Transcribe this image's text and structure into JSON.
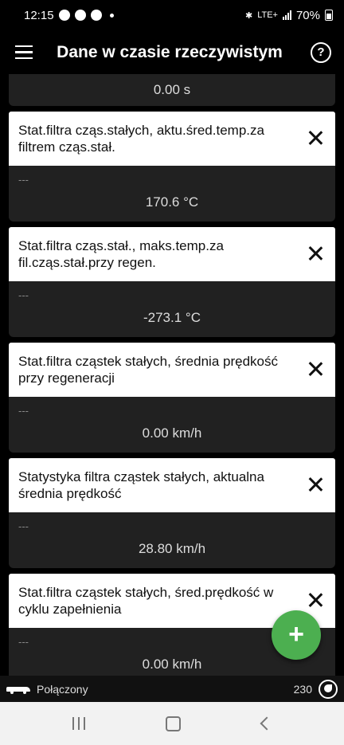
{
  "status_bar": {
    "time": "12:15",
    "network": "LTE+",
    "battery": "70%"
  },
  "app_bar": {
    "title": "Dane w czasie rzeczywistym",
    "help": "?"
  },
  "top_card": {
    "value": "0.00 s"
  },
  "cards": [
    {
      "title": "Stat.filtra cząs.stałych, aktu.śred.temp.za filtrem cząs.stał.",
      "sub": "---",
      "value": "170.6 °C"
    },
    {
      "title": "Stat.filtra cząs.stał., maks.temp.za fil.cząs.stał.przy regen.",
      "sub": "---",
      "value": "-273.1 °C"
    },
    {
      "title": "Stat.filtra cząstek stałych, średnia prędkość przy regeneracji",
      "sub": "---",
      "value": "0.00 km/h"
    },
    {
      "title": "Statystyka filtra cząstek stałych, aktualna średnia prędkość",
      "sub": "---",
      "value": "28.80 km/h"
    },
    {
      "title": "Stat.filtra cząstek stałych, śred.prędkość w cyklu zapełnienia",
      "sub": "---",
      "value": "0.00 km/h"
    }
  ],
  "fab": {
    "label": "+"
  },
  "bottom_bar": {
    "connection": "Połączony",
    "count": "230"
  }
}
